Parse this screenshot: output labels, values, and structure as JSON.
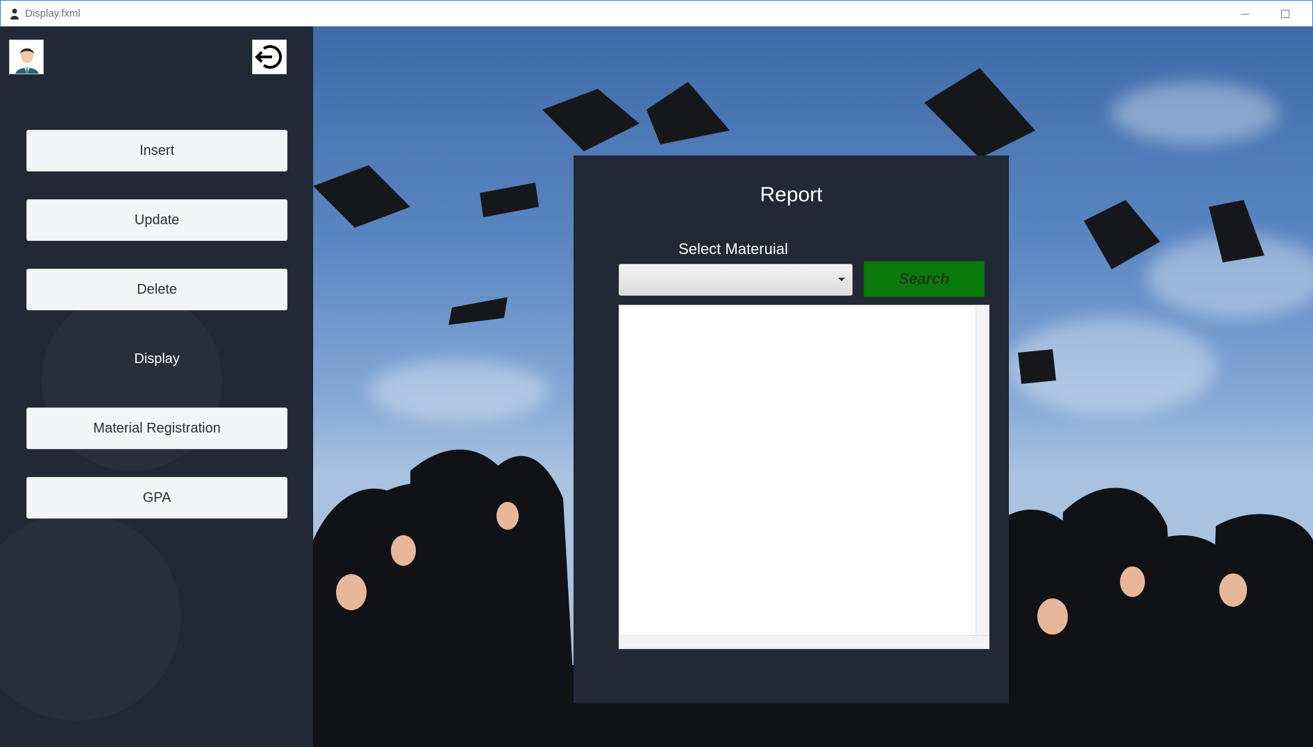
{
  "window": {
    "title": "Display.fxml"
  },
  "sidebar": {
    "avatar_icon": "user-avatar-icon",
    "logout_icon": "logout-icon",
    "items": [
      {
        "label": "Insert",
        "type": "button"
      },
      {
        "label": "Update",
        "type": "button"
      },
      {
        "label": "Delete",
        "type": "button"
      },
      {
        "label": "Display",
        "type": "label"
      },
      {
        "label": "Material Registration",
        "type": "button"
      },
      {
        "label": "GPA",
        "type": "button"
      }
    ]
  },
  "report": {
    "title": "Report",
    "select_label": "Select Materuial",
    "select_value": "",
    "search_label": "Search",
    "search_color": "#0a7a0a"
  },
  "colors": {
    "sidebar_bg": "#222835",
    "panel_bg": "#222835",
    "accent_green": "#0a7a0a"
  }
}
